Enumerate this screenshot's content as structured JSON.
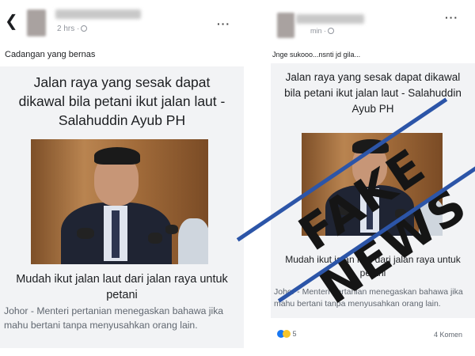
{
  "left_post": {
    "back_icon": "chevron-left-icon",
    "time": "2 hrs ·",
    "more": "···",
    "caption": "Cadangan yang bernas",
    "headline": "Jalan raya yang sesak dapat dikawal bila petani ikut jalan laut - Salahuddin Ayub PH",
    "subheadline": "Mudah ikut jalan laut dari jalan raya untuk petani",
    "description": "Johor - Menteri pertanian menegaskan bahawa jika mahu bertani tanpa menyusahkan orang lain."
  },
  "right_post": {
    "time": "min ·",
    "more": "···",
    "caption": "Jnge sukooo...nsnti jd gila...",
    "headline": "Jalan raya yang sesak dapat dikawal bila petani ikut jalan laut - Salahuddin Ayub PH",
    "subheadline": "Mudah ikut jalan laut dari jalan raya untuk petani",
    "description": "Johor - Menteri pertanian menegaskan bahawa jika mahu bertani tanpa menyusahkan orang lain.",
    "reaction_count": "5",
    "comments": "4 Komen"
  },
  "stamp": {
    "text": "FAKE NEWS",
    "rule_color": "#2c55a8"
  }
}
